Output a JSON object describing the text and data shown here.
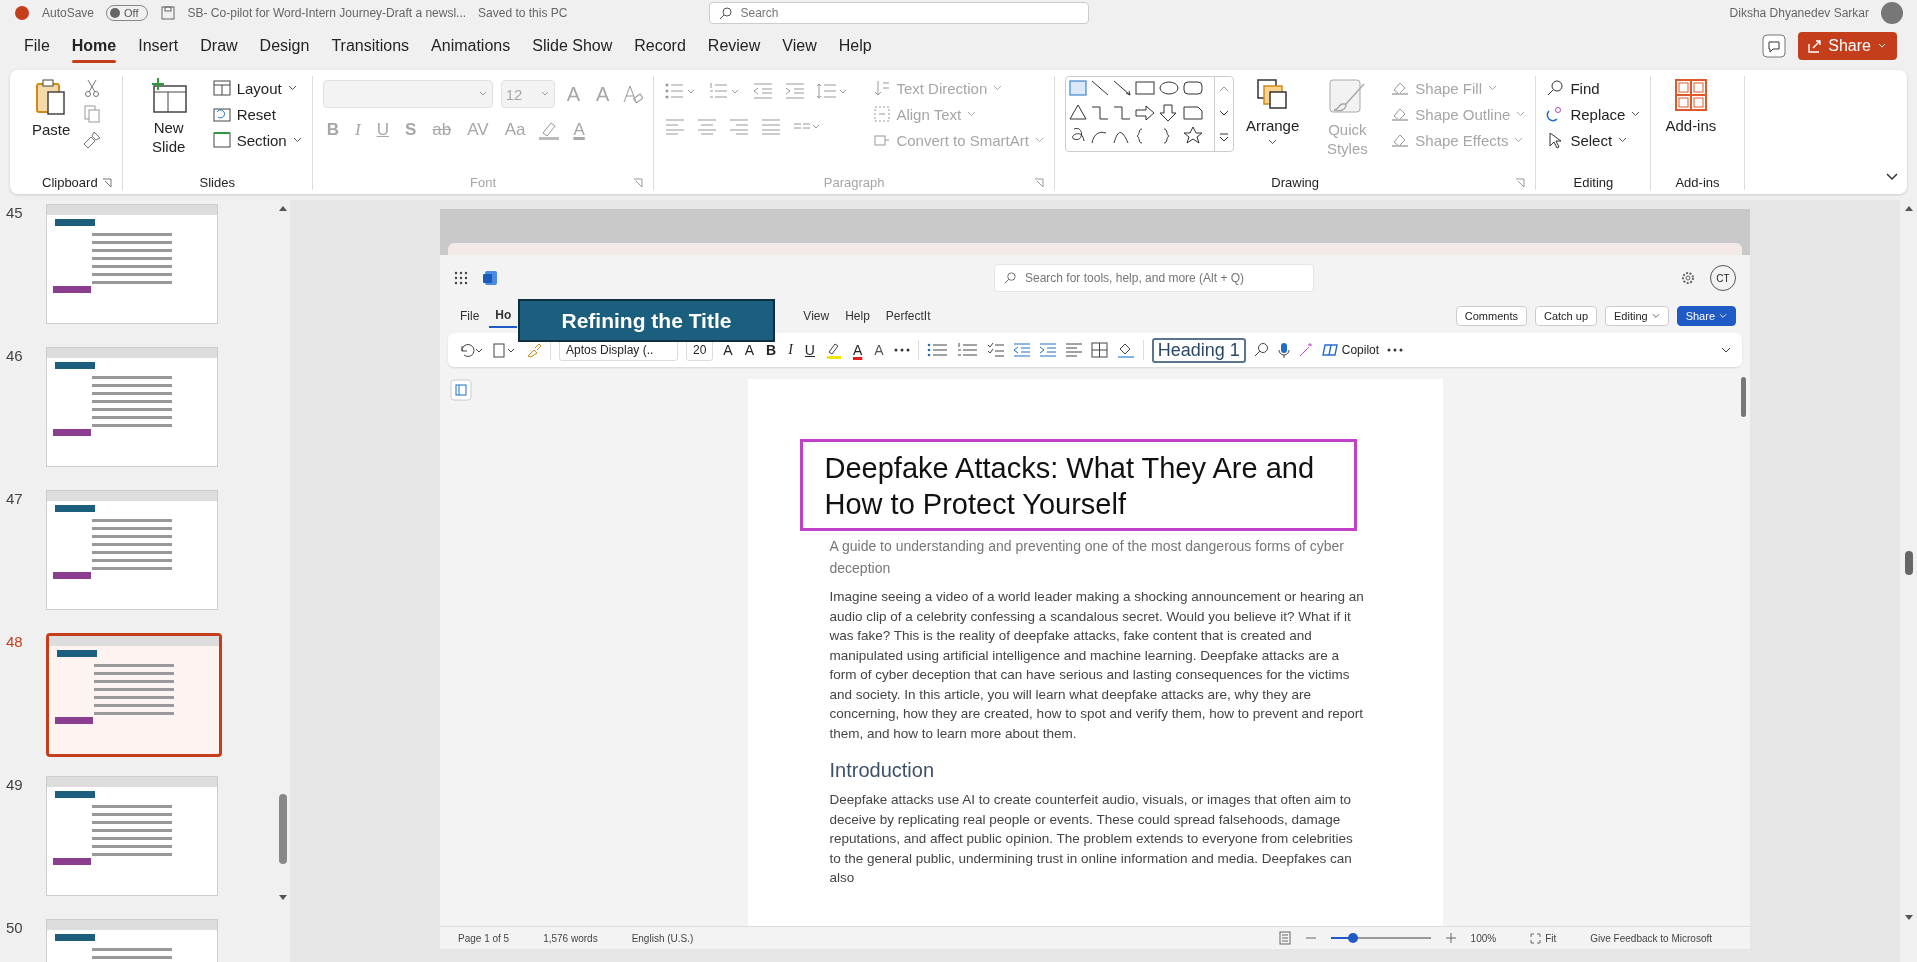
{
  "title_bar": {
    "autosave": "AutoSave",
    "autosave_on": false,
    "autosave_state": "Off",
    "document": "SB- Co-pilot for Word-Intern Journey-Draft a newsl...",
    "save_status": "Saved to this PC",
    "search_placeholder": "Search",
    "user": "Diksha Dhyanedev Sarkar"
  },
  "menu": [
    {
      "label": "File",
      "selected": false
    },
    {
      "label": "Home",
      "selected": true
    },
    {
      "label": "Insert",
      "selected": false
    },
    {
      "label": "Draw",
      "selected": false
    },
    {
      "label": "Design",
      "selected": false
    },
    {
      "label": "Transitions",
      "selected": false
    },
    {
      "label": "Animations",
      "selected": false
    },
    {
      "label": "Slide Show",
      "selected": false
    },
    {
      "label": "Record",
      "selected": false
    },
    {
      "label": "Review",
      "selected": false
    },
    {
      "label": "View",
      "selected": false
    },
    {
      "label": "Help",
      "selected": false
    }
  ],
  "share": "Share",
  "ribbon": {
    "clipboard": {
      "paste": "Paste",
      "label": "Clipboard"
    },
    "slides": {
      "new_slide": "New Slide",
      "layout": "Layout",
      "reset": "Reset",
      "section": "Section",
      "label": "Slides"
    },
    "font": {
      "disabled": true,
      "size": "12",
      "grow_shrink": [
        "A",
        "A"
      ],
      "buttons": [
        "B",
        "I",
        "U",
        "S",
        "ab",
        "AV",
        "Aa"
      ],
      "color_letter": "A",
      "label": "Font"
    },
    "paragraph": {
      "disabled": true,
      "text_direction": "Text Direction",
      "align_text": "Align Text",
      "smartart": "Convert to SmartArt",
      "label": "Paragraph"
    },
    "drawing": {
      "arrange": "Arrange",
      "quick_styles": "Quick Styles",
      "quick_styles_disabled": true,
      "shape_items": [
        {
          "label": "Shape Fill",
          "disabled": true
        },
        {
          "label": "Shape Outline",
          "disabled": true
        },
        {
          "label": "Shape Effects",
          "disabled": true
        }
      ],
      "label": "Drawing"
    },
    "editing": {
      "find": "Find",
      "replace": "Replace",
      "select": "Select",
      "label": "Editing"
    },
    "addins": {
      "button": "Add-ins",
      "label": "Add-ins"
    }
  },
  "thumbnails": [
    {
      "number": "45",
      "selected": false
    },
    {
      "number": "46",
      "selected": false
    },
    {
      "number": "47",
      "selected": false
    },
    {
      "number": "48",
      "selected": true
    },
    {
      "number": "49",
      "selected": false
    },
    {
      "number": "50",
      "selected": false
    }
  ],
  "slide": {
    "callout": "Refining the Title",
    "word": {
      "search_placeholder": "Search for tools, help, and more (Alt + Q)",
      "avatar": "CT",
      "tabs": [
        {
          "label": "File",
          "selected": false
        },
        {
          "label": "Ho",
          "selected": true
        },
        {
          "label": "View",
          "selected": false
        },
        {
          "label": "Help",
          "selected": false
        },
        {
          "label": "PerfectIt",
          "selected": false
        }
      ],
      "actions": [
        {
          "label": "Comments",
          "kind": "plain"
        },
        {
          "label": "Catch up",
          "kind": "plain"
        },
        {
          "label": "Editing",
          "kind": "plain"
        },
        {
          "label": "Share",
          "kind": "primary"
        }
      ],
      "toolbar": {
        "font": "Aptos Display (..",
        "size": "20",
        "grow_shrink": [
          "A",
          "A"
        ],
        "format": [
          "B",
          "I",
          "U"
        ],
        "color_letter": "A",
        "clear_letter": "A",
        "style": "Heading 1",
        "copilot": "Copilot"
      },
      "document": {
        "title": "Deepfake Attacks: What They Are and How to Protect Yourself",
        "subtitle": "A guide to understanding and preventing one of the most dangerous forms of cyber deception",
        "paragraphs": [
          {
            "kind": "body",
            "text": "Imagine seeing a video of a world leader making a shocking announcement or hearing an audio clip of a celebrity confessing a scandalous secret. Would you believe it? What if it was fake? This is the reality of deepfake attacks, fake content that is created and manipulated using artificial intelligence and machine learning. Deepfake attacks are a form of cyber deception that can have serious and lasting consequences for the victims and society. In this article, you will learn what deepfake attacks are, why they are concerning, how they are created, how to spot and verify them, how to prevent and report them, and how to learn more about them."
          },
          {
            "kind": "heading",
            "text": "Introduction"
          },
          {
            "kind": "body",
            "text": "Deepfake attacks use AI to create counterfeit audio, visuals, or images that often aim to deceive by replicating real people or events. These could spread falsehoods, damage reputations, and affect public opinion. The problem extends to everyone from celebrities to the general public, undermining trust in online information and media. Deepfakes can also"
          }
        ]
      },
      "status": {
        "items": [
          "Page 1 of 5",
          "1,576 words",
          "English (U.S.)"
        ],
        "zoom": {
          "level": 0.22,
          "reading": "100%"
        },
        "fit": "Fit",
        "feedback": "Give Feedback to Microsoft"
      }
    }
  }
}
